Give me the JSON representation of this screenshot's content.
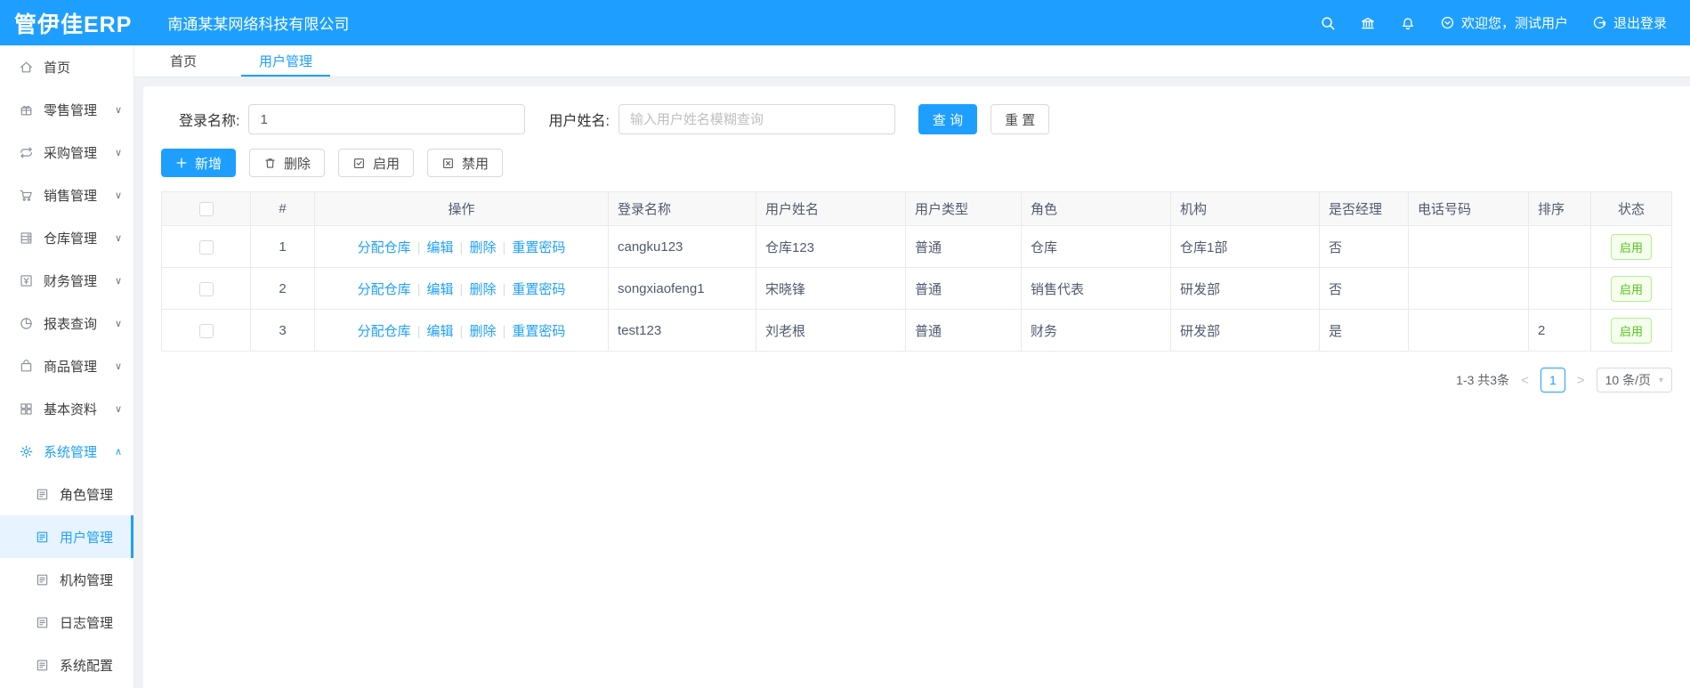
{
  "colors": {
    "topbar": "#1E9FFF",
    "accent": "#1E9FFF",
    "link": "#1E9FFF",
    "active_menu_bg": "#e7f4ff",
    "status_enabled_text": "#52c41a",
    "status_enabled_bg": "#f6ffed",
    "status_enabled_border": "#b7eb8f"
  },
  "header": {
    "logo": "管伊佳ERP",
    "company": "南通某某网络科技有限公司",
    "welcome": "欢迎您，测试用户",
    "logout": "退出登录",
    "icons": [
      "search-icon",
      "bank-icon",
      "bell-icon",
      "user-circle-icon",
      "logout-icon"
    ]
  },
  "sidebar": {
    "items": [
      {
        "key": "home",
        "label": "首页",
        "icon": "home-icon"
      },
      {
        "key": "retail",
        "label": "零售管理",
        "icon": "gift-icon",
        "chevron": "down"
      },
      {
        "key": "purchase",
        "label": "采购管理",
        "icon": "sync-icon",
        "chevron": "down"
      },
      {
        "key": "sales",
        "label": "销售管理",
        "icon": "cart-icon",
        "chevron": "down"
      },
      {
        "key": "warehouse",
        "label": "仓库管理",
        "icon": "cabinet-icon",
        "chevron": "down"
      },
      {
        "key": "finance",
        "label": "财务管理",
        "icon": "finance-icon",
        "chevron": "down"
      },
      {
        "key": "report",
        "label": "报表查询",
        "icon": "pie-icon",
        "chevron": "down"
      },
      {
        "key": "goods",
        "label": "商品管理",
        "icon": "bag-icon",
        "chevron": "down"
      },
      {
        "key": "basic-data",
        "label": "基本资料",
        "icon": "grid-icon",
        "chevron": "down"
      },
      {
        "key": "system",
        "label": "系统管理",
        "icon": "gear-icon",
        "chevron": "up",
        "active": true,
        "children": [
          {
            "key": "role",
            "label": "角色管理",
            "icon": "doc-icon"
          },
          {
            "key": "user",
            "label": "用户管理",
            "icon": "doc-icon",
            "active": true
          },
          {
            "key": "org",
            "label": "机构管理",
            "icon": "doc-icon"
          },
          {
            "key": "log",
            "label": "日志管理",
            "icon": "doc-icon"
          },
          {
            "key": "config",
            "label": "系统配置",
            "icon": "doc-icon"
          }
        ]
      }
    ]
  },
  "tabs": [
    {
      "label": "首页",
      "active": false
    },
    {
      "label": "用户管理",
      "active": true
    }
  ],
  "search": {
    "login_label": "登录名称:",
    "login_value": "1",
    "name_label": "用户姓名:",
    "name_placeholder": "输入用户姓名模糊查询",
    "query_label": "查 询",
    "reset_label": "重 置"
  },
  "toolbar": {
    "add_label": "新增",
    "delete_label": "删除",
    "enable_label": "启用",
    "disable_label": "禁用"
  },
  "table": {
    "columns": [
      "",
      "#",
      "操作",
      "登录名称",
      "用户姓名",
      "用户类型",
      "角色",
      "机构",
      "是否经理",
      "电话号码",
      "排序",
      "状态"
    ],
    "row_actions": [
      {
        "key": "assign-warehouse",
        "label": "分配仓库"
      },
      {
        "key": "edit",
        "label": "编辑"
      },
      {
        "key": "delete",
        "label": "删除"
      },
      {
        "key": "reset-password",
        "label": "重置密码"
      }
    ],
    "rows": [
      {
        "index": "1",
        "login_name": "cangku123",
        "user_name": "仓库123",
        "user_type": "普通",
        "role": "仓库",
        "org": "仓库1部",
        "is_manager": "否",
        "phone": "",
        "sort": "",
        "status": "启用"
      },
      {
        "index": "2",
        "login_name": "songxiaofeng1",
        "user_name": "宋晓锋",
        "user_type": "普通",
        "role": "销售代表",
        "org": "研发部",
        "is_manager": "否",
        "phone": "",
        "sort": "",
        "status": "启用"
      },
      {
        "index": "3",
        "login_name": "test123",
        "user_name": "刘老根",
        "user_type": "普通",
        "role": "财务",
        "org": "研发部",
        "is_manager": "是",
        "phone": "",
        "sort": "2",
        "status": "启用"
      }
    ]
  },
  "pagination": {
    "total": "1-3 共3条",
    "prev": "<",
    "current_page": "1",
    "next": ">",
    "page_size": "10 条/页"
  }
}
